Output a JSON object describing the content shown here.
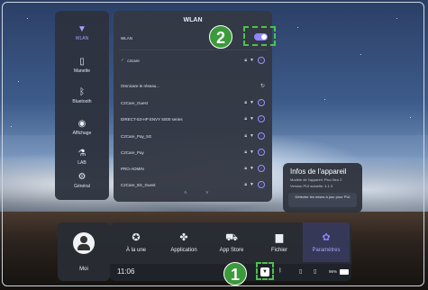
{
  "side_nav": [
    {
      "id": "wlan",
      "label": "WLAN",
      "icon": "wifi-icon",
      "active": true
    },
    {
      "id": "manette",
      "label": "Manette",
      "icon": "controller-icon",
      "active": false
    },
    {
      "id": "bluetooth",
      "label": "Bluetooth",
      "icon": "bluetooth-icon",
      "active": false
    },
    {
      "id": "affichage",
      "label": "Affichage",
      "icon": "eye-icon",
      "active": false
    },
    {
      "id": "lab",
      "label": "LAB",
      "icon": "flask-icon",
      "active": false
    },
    {
      "id": "general",
      "label": "Général",
      "icon": "gear-icon",
      "active": false
    }
  ],
  "wlan_panel": {
    "title": "WLAN",
    "toggle_label": "WLAN",
    "connected": "c2care",
    "scanning_label": "Omnicare le réseau...",
    "networks": [
      "C2Care_Guest",
      "DIRECT-53-HP ENVY 5000 series",
      "C2Care_Pay_5G",
      "C2Care_Pay",
      "PRO-ADMIN",
      "C2Care_5G_Guest"
    ]
  },
  "device_info": {
    "title": "Infos de l'appareil",
    "line1": "Modèle de l'appareil: Pico Neo 2",
    "line2": "Version PUI actuelle: 4.1.3",
    "button": "Détecter les mises à jour pour PUI"
  },
  "user": {
    "label": "Moi"
  },
  "dock": [
    {
      "label": "À la une",
      "icon": "star-icon",
      "active": false
    },
    {
      "label": "Application",
      "icon": "grid-icon",
      "active": false
    },
    {
      "label": "App Store",
      "icon": "cart-icon",
      "active": false
    },
    {
      "label": "Fichier",
      "icon": "folder-icon",
      "active": false
    },
    {
      "label": "Paramètres",
      "icon": "settings-icon",
      "active": true
    }
  ],
  "status_bar": {
    "time": "11:06",
    "battery": "96%"
  },
  "callouts": {
    "one": "1",
    "two": "2"
  },
  "colors": {
    "accent": "#8e86ff",
    "callout": "#3b9a3b"
  }
}
